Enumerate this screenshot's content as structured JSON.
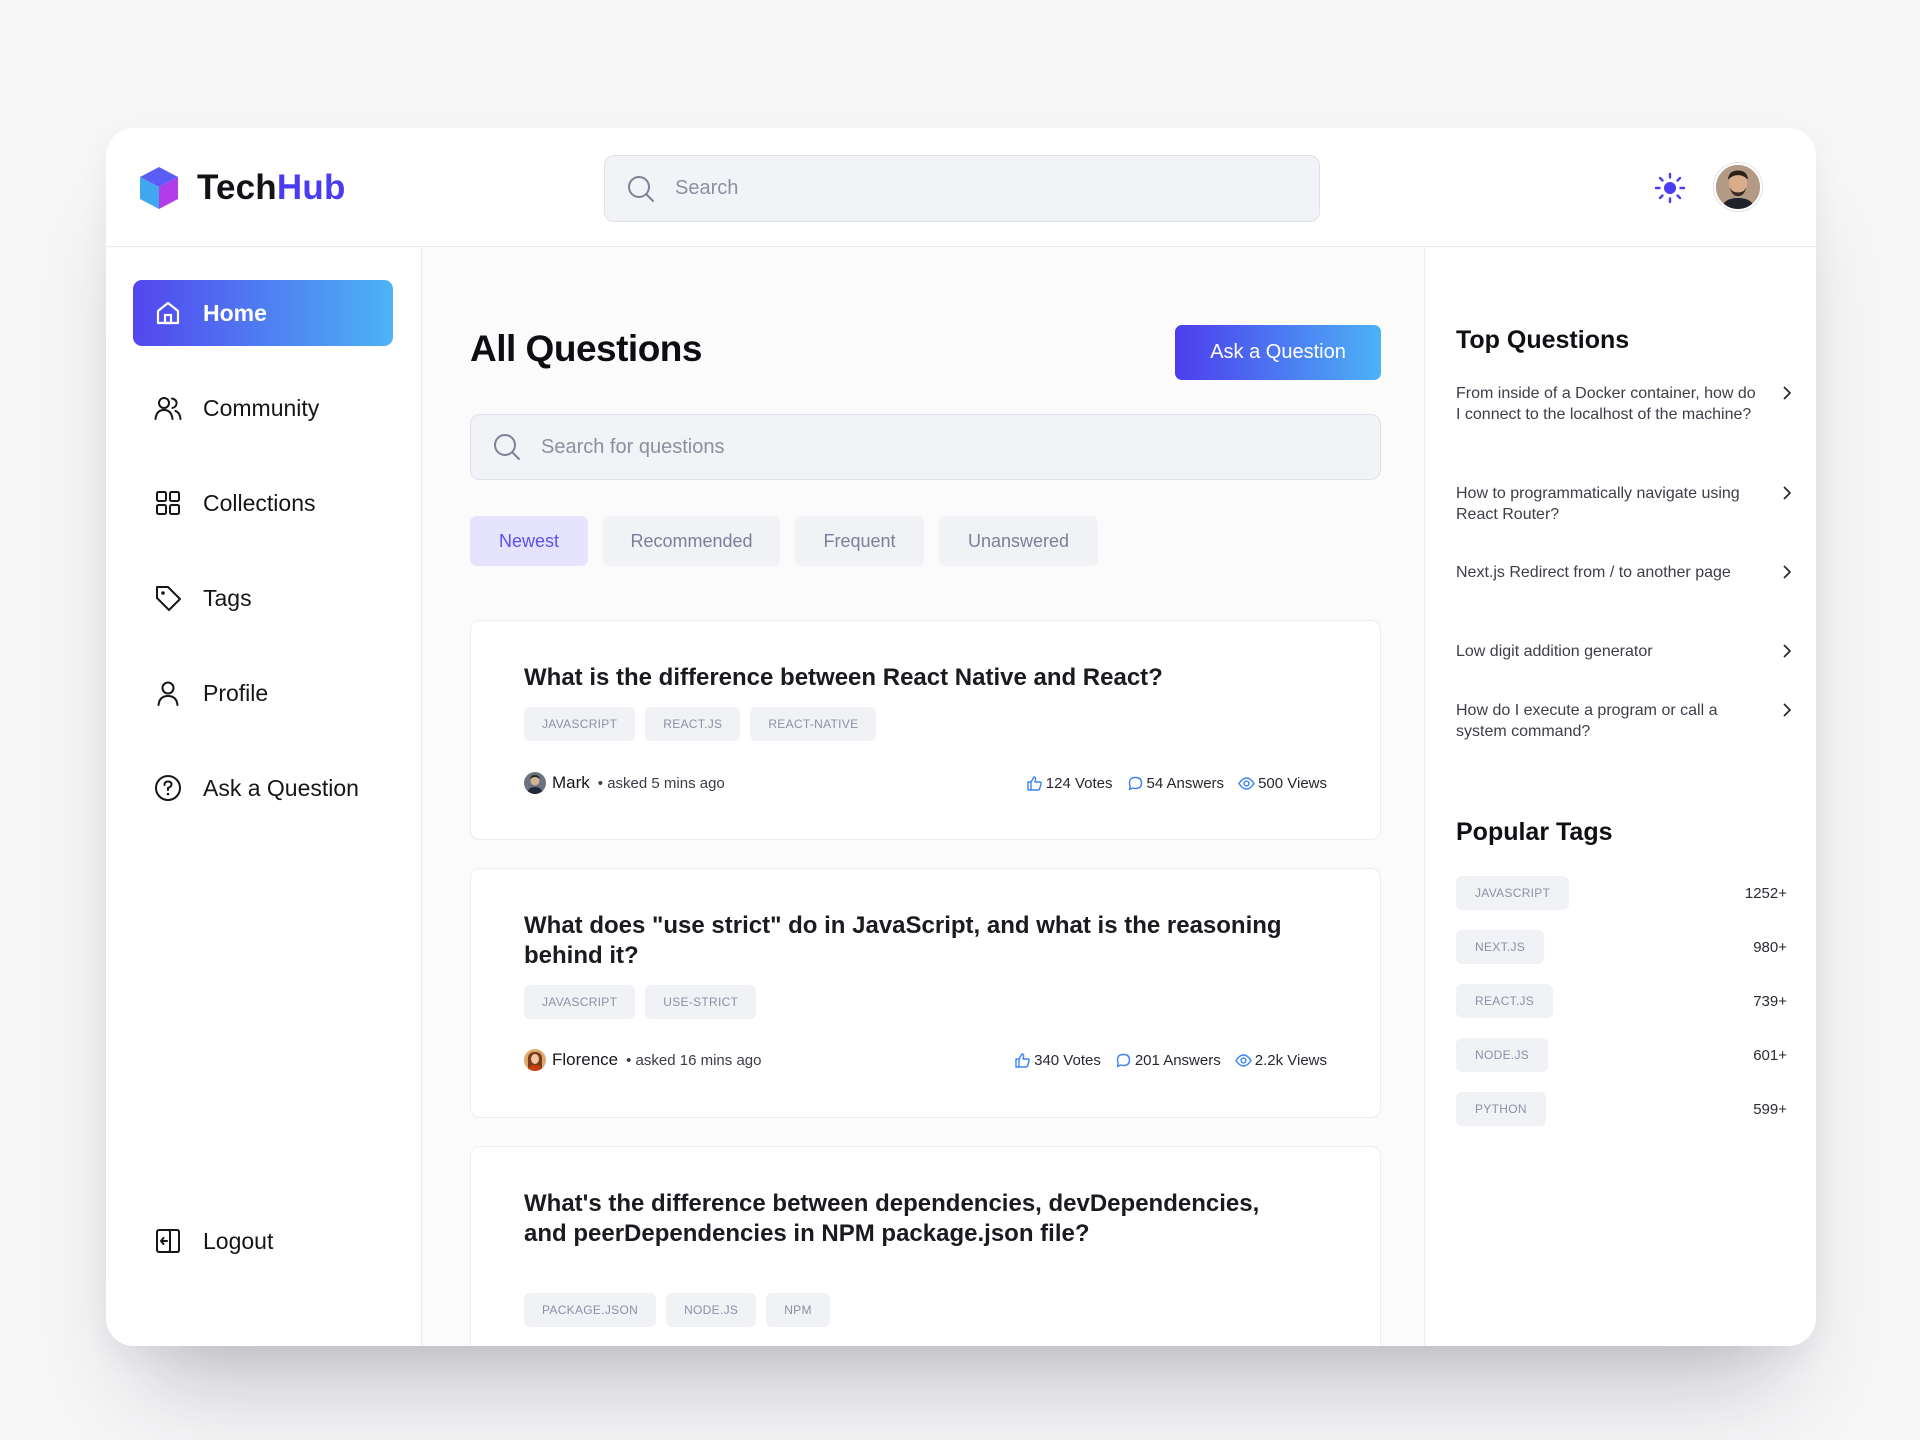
{
  "app": {
    "name_part1": "Tech",
    "name_part2": "Hub"
  },
  "header": {
    "search_placeholder": "Search"
  },
  "sidebar": {
    "items": [
      {
        "label": "Home",
        "icon": "home-icon"
      },
      {
        "label": "Community",
        "icon": "users-icon"
      },
      {
        "label": "Collections",
        "icon": "grid-icon"
      },
      {
        "label": "Tags",
        "icon": "tag-icon"
      },
      {
        "label": "Profile",
        "icon": "user-icon"
      },
      {
        "label": "Ask a Question",
        "icon": "help-circle-icon"
      }
    ],
    "logout": "Logout"
  },
  "main": {
    "title": "All Questions",
    "ask_button": "Ask a Question",
    "search_placeholder": "Search for questions",
    "filters": [
      "Newest",
      "Recommended",
      "Frequent",
      "Unanswered"
    ],
    "questions": [
      {
        "title": "What is the difference between React Native and React?",
        "tags": [
          "JAVASCRIPT",
          "REACT.JS",
          "REACT-NATIVE"
        ],
        "author": "Mark",
        "asked": "• asked 5 mins ago",
        "votes": "124 Votes",
        "answers": "54 Answers",
        "views": "500 Views"
      },
      {
        "title": "What does \"use strict\" do in JavaScript, and what is the reasoning behind it?",
        "tags": [
          "JAVASCRIPT",
          "USE-STRICT"
        ],
        "author": "Florence",
        "asked": "• asked 16 mins ago",
        "votes": "340 Votes",
        "answers": "201 Answers",
        "views": "2.2k Views"
      },
      {
        "title": "What's the difference between dependencies, devDependencies, and peerDependencies in NPM package.json file?",
        "tags": [
          "PACKAGE.JSON",
          "NODE.JS",
          "NPM"
        ]
      }
    ]
  },
  "right": {
    "top_title": "Top Questions",
    "top_questions": [
      "From inside of a Docker container, how do I connect to the localhost of the machine?",
      "How to programmatically navigate using React Router?",
      "Next.js Redirect from / to another page",
      "Low digit addition generator",
      "How do I execute a program or call a system command?"
    ],
    "tags_title": "Popular Tags",
    "popular_tags": [
      {
        "name": "JAVASCRIPT",
        "count": "1252+"
      },
      {
        "name": "NEXT.JS",
        "count": "980+"
      },
      {
        "name": "REACT.JS",
        "count": "739+"
      },
      {
        "name": "NODE.JS",
        "count": "601+"
      },
      {
        "name": "PYTHON",
        "count": "599+"
      }
    ]
  },
  "colors": {
    "brand": "#4a3cf0",
    "gradient_start": "#5246ee",
    "gradient_end": "#4cb4f5",
    "filter_active_bg": "#e5e3fd"
  }
}
